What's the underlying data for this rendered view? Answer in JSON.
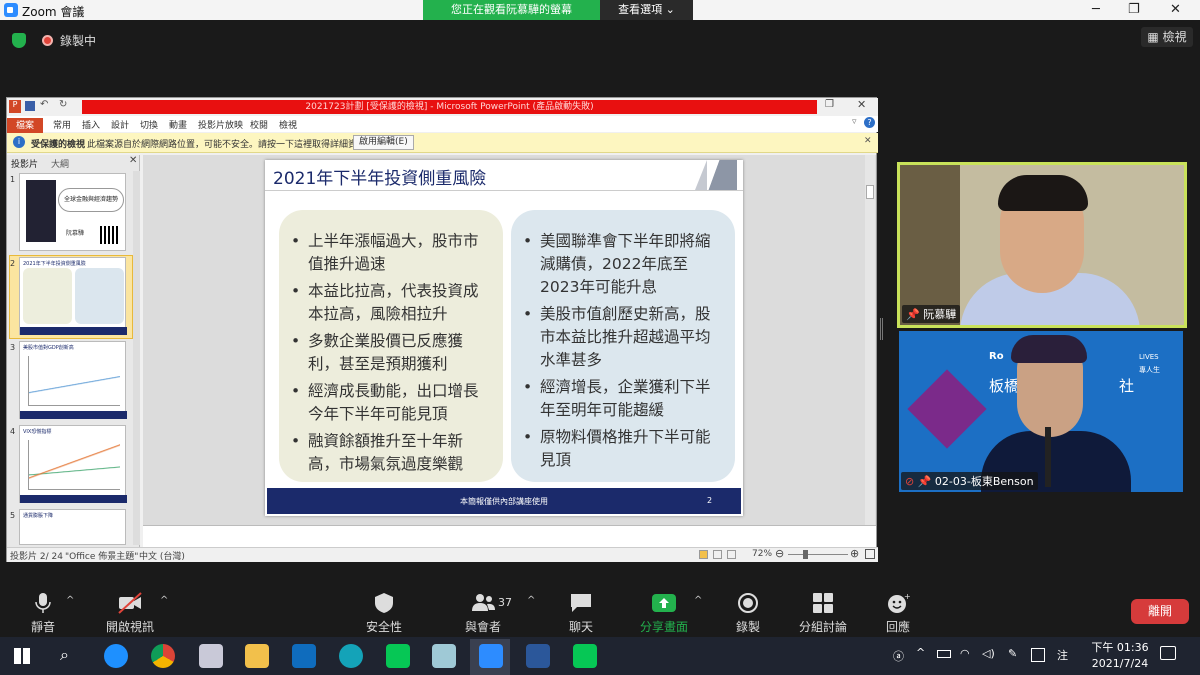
{
  "window": {
    "title": "Zoom 會議"
  },
  "banner": {
    "viewing": "您正在觀看阮慕驊的螢幕",
    "view_options": "查看選項"
  },
  "status": {
    "recording": "錄製中",
    "view_button": "檢視"
  },
  "ppt": {
    "window_title": "2021723計劃 [受保護的檢視] - Microsoft PowerPoint (產品啟動失敗)",
    "menu": [
      "檔案",
      "常用",
      "插入",
      "設計",
      "切換",
      "動畫",
      "投影片放映",
      "校閱",
      "檢視"
    ],
    "warning_title": "受保護的檢視",
    "warning_text": "此檔案源自於網際網路位置，可能不安全。請按一下這裡取得詳細資料。",
    "enable_editing": "啟用編輯(E)",
    "panel_tabs": [
      "投影片",
      "大綱"
    ],
    "thumbs": {
      "t1": "全球金融與經濟趨勢",
      "t1_name": "阮慕驊",
      "t2": "2021年下半年投資側重風險",
      "t3": "美股市值對GDP創新高",
      "t4": "VIX恐慌指標",
      "t5": "通貨膨脹下降"
    },
    "slide": {
      "title": "2021年下半年投資側重風險",
      "left_items": [
        "上半年漲幅過大，股市市值推升過速",
        "本益比拉高，代表投資成本拉高，風險相拉升",
        "多數企業股價已反應獲利，甚至是預期獲利",
        "經濟成長動能，出口增長今年下半年可能見頂",
        "融資餘額推升至十年新高，市場氣氛過度樂觀"
      ],
      "right_items": [
        "美國聯準會下半年即將縮減購債，2022年底至2023年可能升息",
        "美股市值創歷史新高，股市本益比推升超越過平均水準甚多",
        "經濟增長，企業獲利下半年至明年可能趨緩",
        "原物料價格推升下半可能見頂"
      ],
      "footer": "本簡報僅供內部講座使用",
      "page": "2"
    },
    "statusbar": {
      "slide_count": "投影片 2/ 24",
      "theme": "\"Office 佈景主題\"",
      "language": "中文 (台灣)",
      "zoom": "72%"
    }
  },
  "videos": [
    {
      "name": "阮慕驊"
    },
    {
      "name": "02-03-板東Benson",
      "bg_text": "板橋",
      "bg_text2": "社",
      "logo": "Ro",
      "lives": "LIVES",
      "sub": "專人生"
    }
  ],
  "toolbar": {
    "mute": "靜音",
    "video": "開啟視訊",
    "security": "安全性",
    "participants": "與會者",
    "participant_count": "37",
    "chat": "聊天",
    "share": "分享畫面",
    "record": "錄製",
    "breakout": "分組討論",
    "reactions": "回應",
    "leave": "離開"
  },
  "taskbar": {
    "time": "下午 01:36",
    "date": "2021/7/24",
    "ime": "注"
  },
  "colors": {
    "accent_green": "#23b14d",
    "zoom_blue": "#2d8cff",
    "leave_red": "#d63b3b",
    "slide_navy": "#1b2a6b"
  }
}
